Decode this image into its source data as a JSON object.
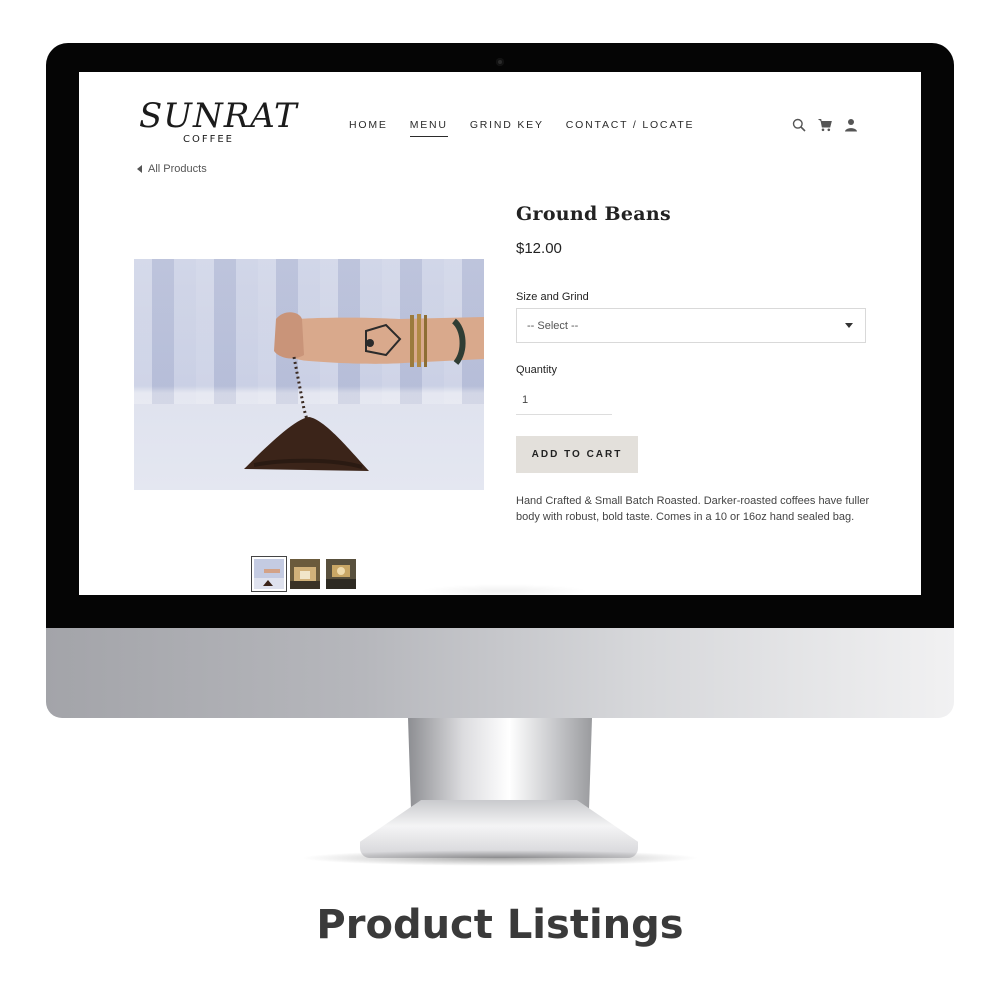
{
  "site": {
    "logo": {
      "main": "SUNRAT",
      "sub": "COFFEE"
    },
    "nav": {
      "items": [
        {
          "label": "HOME",
          "active": false
        },
        {
          "label": "MENU",
          "active": true
        },
        {
          "label": "GRIND KEY",
          "active": false
        },
        {
          "label": "CONTACT / LOCATE",
          "active": false
        }
      ]
    },
    "header_icons": [
      "search-icon",
      "cart-icon",
      "account-icon"
    ],
    "back_link": "All Products"
  },
  "product": {
    "title": "Ground Beans",
    "price": "$12.00",
    "size_grind": {
      "label": "Size and Grind",
      "selected": "-- Select --"
    },
    "quantity": {
      "label": "Quantity",
      "value": "1"
    },
    "add_to_cart": "ADD TO CART",
    "description_lines": [
      " Hand Crafted & Small Batch Roasted. Darker-roasted coffees have fuller",
      "body with robust, bold taste. Comes in a 10 or 16oz hand sealed bag."
    ],
    "thumbnails": [
      "coffee-pour-thumbnail",
      "shop-thumbnail",
      "counter-thumbnail"
    ]
  },
  "caption": "Product Listings",
  "colors": {
    "button_bg": "#e3e0db",
    "bezel": "#050505",
    "caption": "#3a3a3a"
  }
}
